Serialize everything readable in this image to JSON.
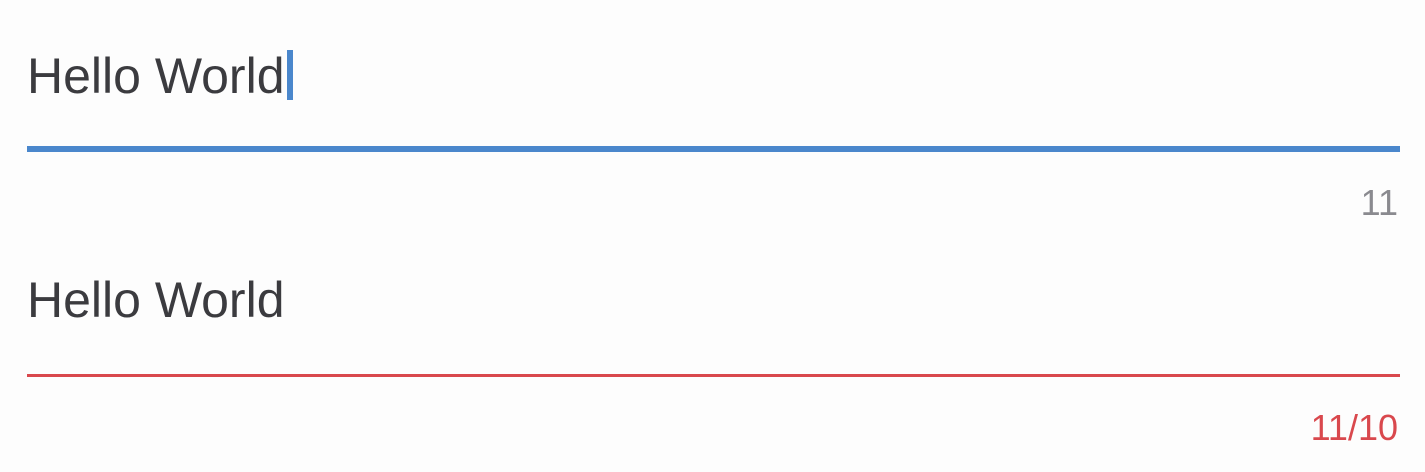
{
  "fields": [
    {
      "value": "Hello World",
      "counter": "11",
      "state": "focused",
      "accent_color": "#4a87cc"
    },
    {
      "value": "Hello World",
      "counter": "11/10",
      "state": "error",
      "accent_color": "#d9484d"
    }
  ]
}
